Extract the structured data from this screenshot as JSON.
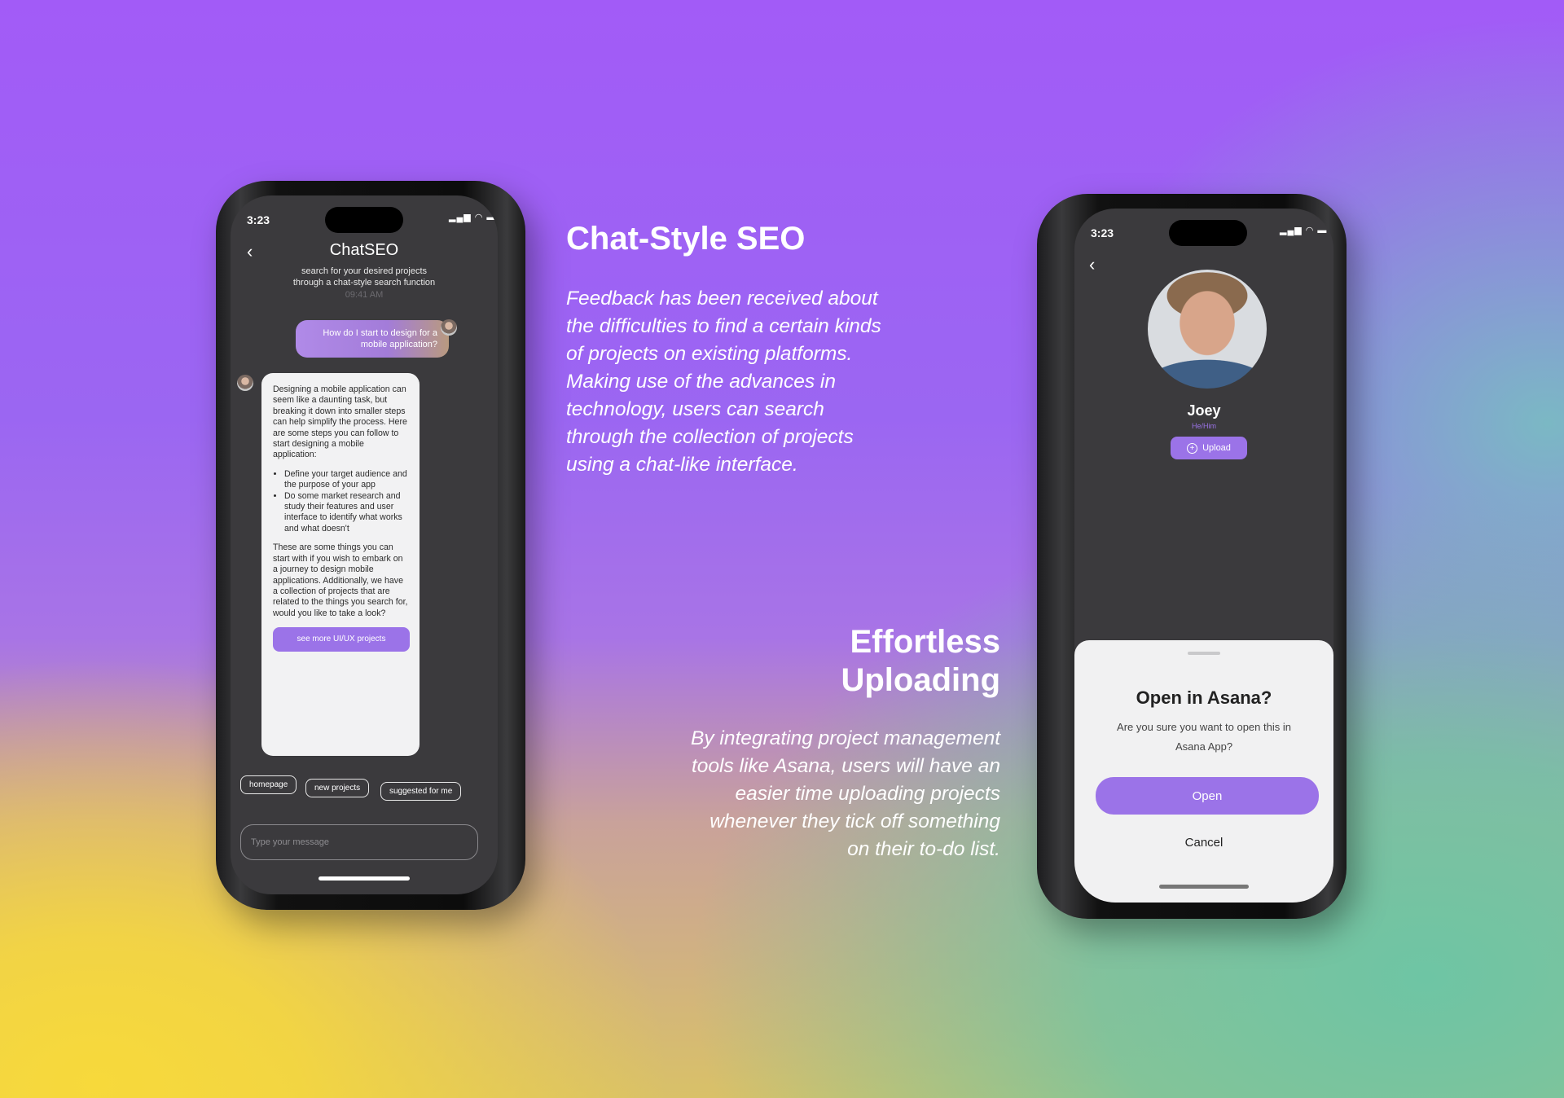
{
  "left_phone": {
    "status_time": "3:23",
    "title": "ChatSEO",
    "subtitle_line1": "search for your desired projects",
    "subtitle_line2": "through a chat-style search function",
    "timestamp": "09:41 AM",
    "user_message_line1": "How do I start to design for a",
    "user_message_line2": "mobile application?",
    "bot_intro": "Designing a mobile application can seem like a daunting task, but breaking it down into smaller steps can help simplify the process. Here are some steps you can follow to start designing a mobile application:",
    "bot_steps": [
      "Define your target audience and the purpose of your app",
      "Do some market research and study their features and user interface to identify what works and what doesn't"
    ],
    "bot_outro": "These are some things you can start with if you wish to embark on a journey to design mobile applications. Additionally, we have a collection of projects that are related to the things you search for, would you like to take a look?",
    "see_more_label": "see more UI/UX projects",
    "chips": [
      "homepage",
      "new projects",
      "suggested for me"
    ],
    "input_placeholder": "Type your message"
  },
  "right_phone": {
    "status_time": "3:23",
    "name": "Joey",
    "pronouns": "He/Him",
    "upload_label": "Upload",
    "sheet_title": "Open in Asana?",
    "sheet_text_line1": "Are you sure you want to open this in",
    "sheet_text_line2": "Asana App?",
    "open_label": "Open",
    "cancel_label": "Cancel"
  },
  "section1": {
    "heading": "Chat-Style SEO",
    "body": "Feedback has been received about the difficulties to find a certain kinds of projects on existing platforms. Making use of the advances in technology, users can search through the collection of projects using a chat-like interface."
  },
  "section2": {
    "heading_line1": "Effortless",
    "heading_line2": "Uploading",
    "body": "By integrating project management tools like Asana, users will have an easier time uploading projects whenever they tick off something on their to-do list."
  },
  "colors": {
    "accent": "#9b73e8",
    "screen_bg": "#3b3a3d",
    "sheet_bg": "#f1f1f2"
  }
}
